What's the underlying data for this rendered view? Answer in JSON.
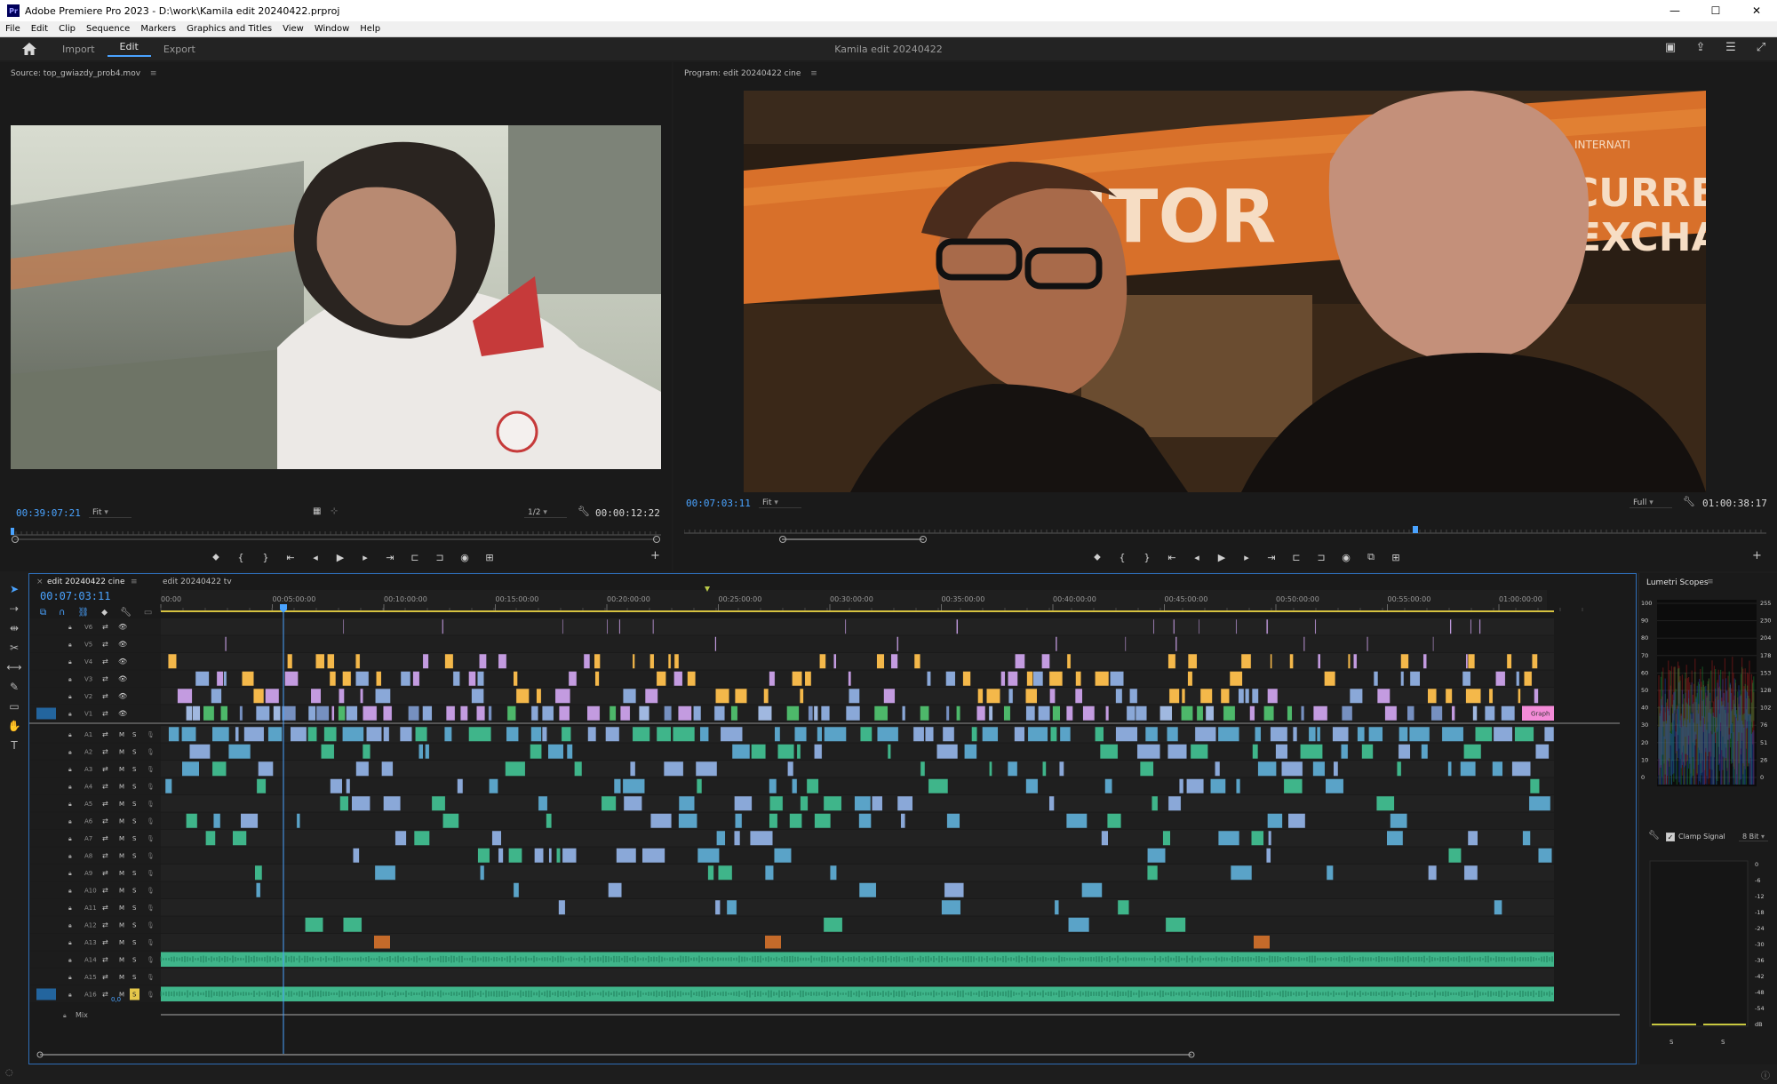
{
  "title_bar": {
    "app_icon": "Pr",
    "title": "Adobe Premiere Pro 2023 - D:\\work\\Kamila edit 20240422.prproj",
    "buttons": [
      "minimize-icon",
      "maximize-icon",
      "close-icon"
    ]
  },
  "menu": [
    "File",
    "Edit",
    "Clip",
    "Sequence",
    "Markers",
    "Graphics and Titles",
    "View",
    "Window",
    "Help"
  ],
  "workspace": {
    "tabs": [
      "Import",
      "Edit",
      "Export"
    ],
    "active_tab": "Edit",
    "project_name": "Kamila edit 20240422"
  },
  "source_monitor": {
    "title": "Source: top_gwiazdy_prob4.mov",
    "current_tc": "00:39:07:21",
    "zoom": "Fit",
    "resolution": "1/2",
    "duration_tc": "00:00:12:22"
  },
  "program_monitor": {
    "title": "Program: edit 20240422 cine",
    "current_tc": "00:07:03:11",
    "zoom": "Fit",
    "resolution": "Full",
    "duration_tc": "01:00:38:17",
    "overlay_sign_1": "ITOR",
    "overlay_sign_2": "CURRENC",
    "overlay_sign_3": "EXCHANG",
    "overlay_sign_4": "INTERNATI"
  },
  "timeline": {
    "tabs": [
      "edit 20240422 cine",
      "edit 20240422 tv"
    ],
    "active_tab": "edit 20240422 cine",
    "current_tc": "00:07:03:11",
    "ruler_labels": [
      "00:00",
      "00:05:00:00",
      "00:10:00:00",
      "00:15:00:00",
      "00:20:00:00",
      "00:25:00:00",
      "00:30:00:00",
      "00:35:00:00",
      "00:40:00:00",
      "00:45:00:00",
      "00:50:00:00",
      "00:55:00:00",
      "01:00:00:00"
    ],
    "video_tracks": [
      "V6",
      "V5",
      "V4",
      "V3",
      "V2",
      "V1"
    ],
    "audio_tracks": [
      "A1",
      "A2",
      "A3",
      "A4",
      "A5",
      "A6",
      "A7",
      "A8",
      "A9",
      "A10",
      "A11",
      "A12",
      "A13",
      "A14",
      "A15",
      "A16"
    ],
    "source_patch_video": "V1",
    "source_patch_audio": "A16",
    "mute_label": "M",
    "solo_label": "S",
    "mix_label": "Mix",
    "mix_value": "0,0",
    "graphic_clip_label": "Graph"
  },
  "lumetri_scopes": {
    "title": "Lumetri Scopes",
    "left_scale": [
      "100",
      "90",
      "80",
      "70",
      "60",
      "50",
      "40",
      "30",
      "20",
      "10",
      "0"
    ],
    "right_scale": [
      "255",
      "230",
      "204",
      "178",
      "153",
      "128",
      "102",
      "76",
      "51",
      "26",
      "0"
    ],
    "clamp_signal_label": "Clamp Signal",
    "bit_depth": "8 Bit",
    "meter_scale": [
      "0",
      "-6",
      "-12",
      "-18",
      "-24",
      "-30",
      "-36",
      "-42",
      "-48",
      "-54",
      "dB"
    ],
    "solo_labels": [
      "S",
      "S"
    ]
  },
  "colors": {
    "accent_blue": "#4aa3ff",
    "video_clip_blue": "#8aa8d8",
    "audio_clip_green": "#3fb58a",
    "graphic_clip_orange": "#f4b84a",
    "adjustment_clip_purple": "#c39be0",
    "graphic_clip_pink": "#f48bd8"
  }
}
